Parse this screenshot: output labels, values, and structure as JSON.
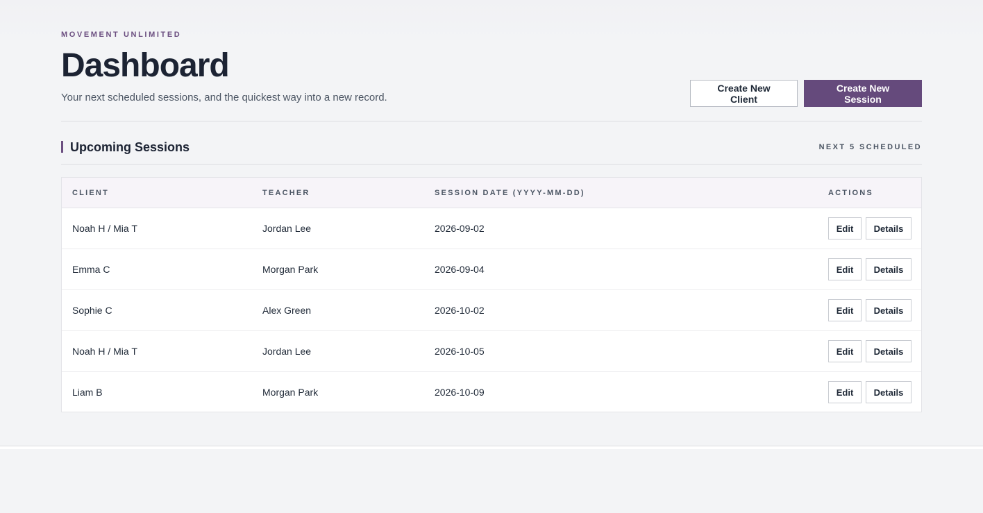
{
  "header": {
    "eyebrow": "MOVEMENT UNLIMITED",
    "title": "Dashboard",
    "subtitle": "Your next scheduled sessions, and the quickest way into a new record.",
    "create_client_label": "Create New Client",
    "create_session_label": "Create New Session"
  },
  "section": {
    "title": "Upcoming Sessions",
    "meta": "NEXT 5 SCHEDULED"
  },
  "table": {
    "columns": {
      "client": "CLIENT",
      "teacher": "TEACHER",
      "date": "SESSION DATE (YYYY-MM-DD)",
      "actions": "ACTIONS"
    },
    "edit_label": "Edit",
    "details_label": "Details",
    "rows": [
      {
        "client": "Noah H / Mia T",
        "teacher": "Jordan Lee",
        "date": "2026-09-02"
      },
      {
        "client": "Emma C",
        "teacher": "Morgan Park",
        "date": "2026-09-04"
      },
      {
        "client": "Sophie C",
        "teacher": "Alex Green",
        "date": "2026-10-02"
      },
      {
        "client": "Noah H / Mia T",
        "teacher": "Jordan Lee",
        "date": "2026-10-05"
      },
      {
        "client": "Liam B",
        "teacher": "Morgan Park",
        "date": "2026-10-09"
      }
    ]
  },
  "colors": {
    "accent": "#654a7c",
    "eyebrow": "#6b4e80",
    "title": "#1c2333"
  }
}
